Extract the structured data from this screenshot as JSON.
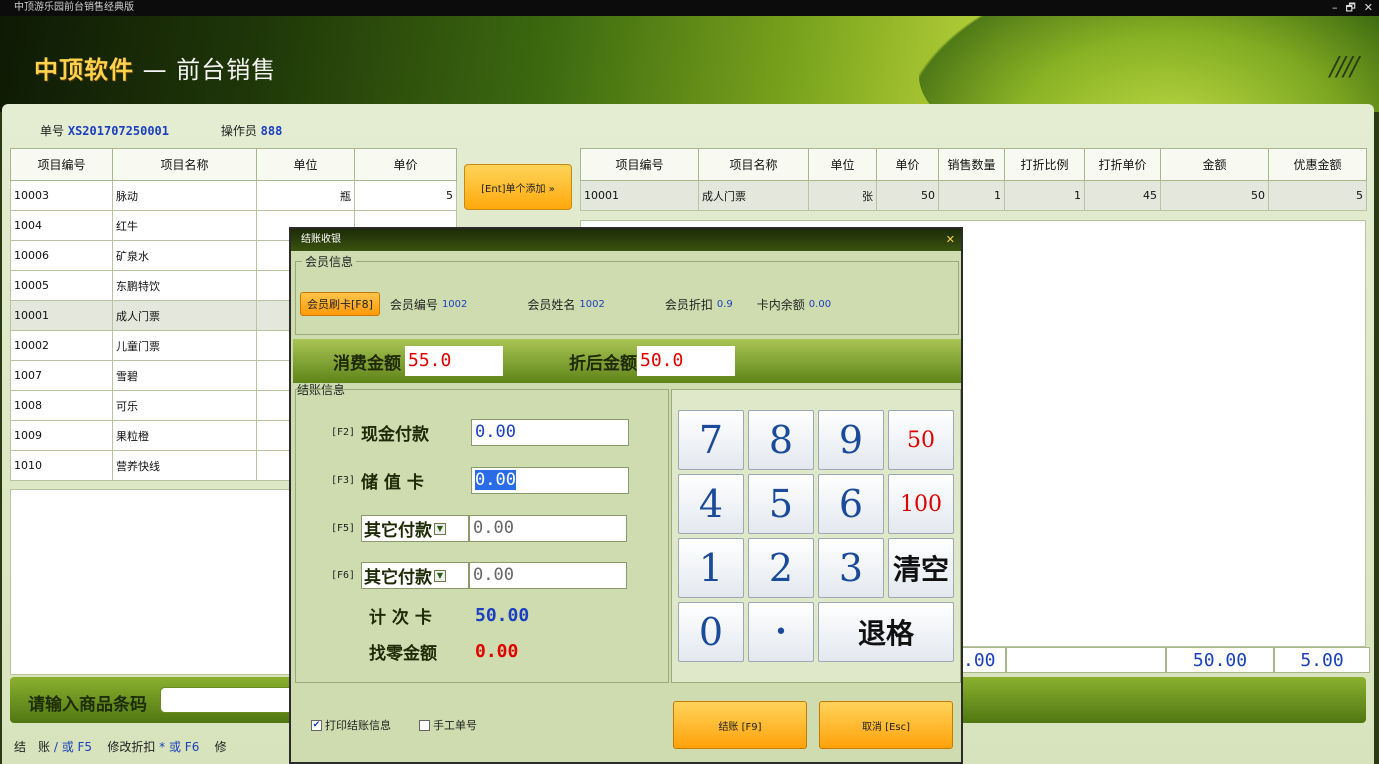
{
  "window": {
    "title": "中顶游乐园前台销售经典版",
    "controls": [
      "–",
      "🗗",
      "✕"
    ]
  },
  "banner": {
    "brand": "中顶软件",
    "subtitle": " — 前台销售"
  },
  "info": {
    "order_label": "单号",
    "order_no": "XS201707250001",
    "operator_label": "操作员",
    "operator": "888"
  },
  "left_table": {
    "headers": [
      "项目编号",
      "项目名称",
      "单位",
      "单价"
    ],
    "rows": [
      [
        "10003",
        "脉动",
        "瓶",
        "5"
      ],
      [
        "1004",
        "红牛",
        "",
        ""
      ],
      [
        "10006",
        "矿泉水",
        "",
        ""
      ],
      [
        "10005",
        "东鹏特饮",
        "",
        ""
      ],
      [
        "10001",
        "成人门票",
        "",
        ""
      ],
      [
        "10002",
        "儿童门票",
        "",
        ""
      ],
      [
        "1007",
        "雪碧",
        "",
        ""
      ],
      [
        "1008",
        "可乐",
        "",
        ""
      ],
      [
        "1009",
        "果粒橙",
        "",
        ""
      ],
      [
        "1010",
        "营养快线",
        "",
        ""
      ]
    ]
  },
  "add_button": "[Ent]单个添加 »",
  "right_table": {
    "headers": [
      "项目编号",
      "项目名称",
      "单位",
      "单价",
      "销售数量",
      "打折比例",
      "打折单价",
      "金额",
      "优惠金额"
    ],
    "rows": [
      [
        "10001",
        "成人门票",
        "张",
        "50",
        "1",
        "1",
        "45",
        "50",
        "5"
      ]
    ]
  },
  "totals": {
    "qty": ".00",
    "amount": "50.00",
    "discount": "5.00"
  },
  "barcode": {
    "label": "请输入商品条码"
  },
  "shortcuts": {
    "settle": "结　账",
    "settle_key": "/ 或 F5",
    "discount": "修改折扣",
    "discount_key": "* 或 F6",
    "modify": "修"
  },
  "dialog": {
    "title": "结账收银",
    "close": "✕",
    "member_legend": "会员信息",
    "swipe_button": "会员刷卡[F8]",
    "member_no_label": "会员编号",
    "member_no": "1002",
    "member_name_label": "会员姓名",
    "member_name": "1002",
    "member_discount_label": "会员折扣",
    "member_discount": "0.9",
    "card_balance_label": "卡内余额",
    "card_balance": "0.00",
    "consume_label": "消费金额",
    "consume_amount": "55.0",
    "after_discount_label": "折后金额",
    "after_discount_amount": "50.0",
    "settle_legend": "结账信息",
    "pay": {
      "cash_key": "[F2]",
      "cash_label": "现金付款",
      "cash_value": "0.00",
      "stored_key": "[F3]",
      "stored_label": "储 值 卡",
      "stored_value": "0.00",
      "other1_key": "[F5]",
      "other1_label": "其它付款",
      "other1_value": "0.00",
      "other2_key": "[F6]",
      "other2_label": "其它付款",
      "other2_value": "0.00",
      "count_card_label": "计 次 卡",
      "count_card_value": "50.00",
      "change_label": "找零金额",
      "change_value": "0.00"
    },
    "keypad": {
      "k7": "7",
      "k8": "8",
      "k9": "9",
      "k50": "50",
      "k4": "4",
      "k5": "5",
      "k6": "6",
      "k100": "100",
      "k1": "1",
      "k2": "2",
      "k3": "3",
      "clear": "清空",
      "k0": "0",
      "dot": "•",
      "backspace": "退格"
    },
    "print_label": "打印结账信息",
    "manual_label": "手工单号",
    "confirm_button": "结账 [F9]",
    "cancel_button": "取消 [Esc]"
  },
  "colors": {
    "accent": "#ffa90b",
    "value_blue": "#1a3fbf",
    "value_red": "#e00000"
  }
}
